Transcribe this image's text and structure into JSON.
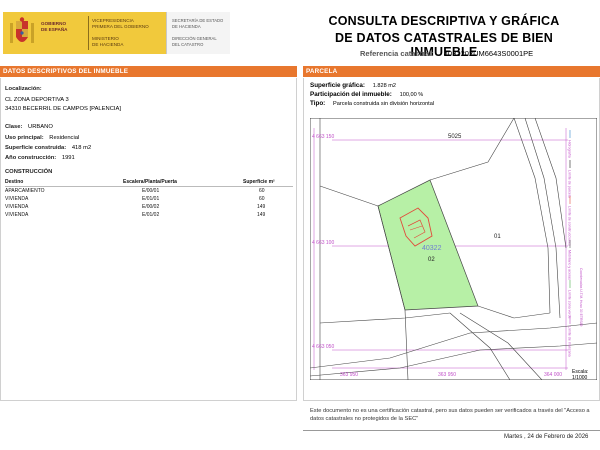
{
  "header": {
    "gov_line1": "GOBIERNO",
    "gov_line2": "DE ESPAÑA",
    "vice_line1": "VICEPRESIDENCIA",
    "vice_line2": "PRIMERA DEL GOBIERNO",
    "vice_line3": "MINISTERIO",
    "vice_line4": "DE HACIENDA",
    "sec_line1": "SECRETARÍA DE ESTADO",
    "sec_line2": "DE HACIENDA",
    "sec_line3": "DIRECCIÓN GENERAL",
    "sec_line4": "DEL CATASTRO",
    "title_line1": "CONSULTA DESCRIPTIVA Y GRÁFICA",
    "title_line2": "DE DATOS CATASTRALES DE BIEN INMUEBLE",
    "ref_label": "Referencia catastral:",
    "ref_value": "4032202UM6643S0001PE",
    "brand_color": "#f1c93c",
    "accent_color": "#e8772e"
  },
  "left": {
    "bar_title": "DATOS DESCRIPTIVOS DEL INMUEBLE",
    "loc_label": "Localización:",
    "loc_line1": "CL ZONA DEPORTIVA 3",
    "loc_line2": "34310 BECERRIL DE CAMPOS [PALENCIA]",
    "clase_label": "Clase:",
    "clase_value": "URBANO",
    "uso_label": "Uso principal:",
    "uso_value": "Residencial",
    "sup_label": "Superficie construida:",
    "sup_value": "418 m2",
    "anio_label": "Año construcción:",
    "anio_value": "1991",
    "constr_title": "CONSTRUCCIÓN",
    "table": {
      "headers": [
        "Destino",
        "Escalera/Planta/Puerta",
        "Superficie m²"
      ],
      "rows": [
        [
          "APARCAMIENTO",
          "E/00/01",
          "60"
        ],
        [
          "VIVIENDA",
          "E/01/01",
          "60"
        ],
        [
          "VIVIENDA",
          "E/00/02",
          "149"
        ],
        [
          "VIVIENDA",
          "E/01/02",
          "149"
        ]
      ]
    }
  },
  "right": {
    "bar_title": "PARCELA",
    "sup_label": "Superficie gráfica:",
    "sup_value": "1.828 m2",
    "part_label": "Participación del inmueble:",
    "part_value": "100,00 %",
    "tipo_label": "Tipo:",
    "tipo_value": "Parcela construida sin división horizontal",
    "map": {
      "coord_top_left": "4 663 150",
      "coord_mid_left": "4 663 100",
      "coord_bot_left": "4 663 050",
      "coord_bottom1": "363 950",
      "coord_bottom2": "363 950",
      "coord_bottom3": "364 000",
      "parcel_5025": "5025",
      "parcel_01": "01",
      "parcel_num": "40322",
      "parcel_02": "02",
      "parcel_fill": "#b7f0a6",
      "building_color": "#e24a3a",
      "legend_1": "Hidrografía",
      "legend_2": "Límite de parcela",
      "legend_3": "Límite de construcciones",
      "legend_4": "Mobiliario y aceras",
      "legend_5": "Límite zona verde",
      "legend_6": "Límite de manzana",
      "coord_system": "Coordenadas U.T.M. Huso 30 ETRS89"
    },
    "scale_label": "Escala:",
    "scale_value": "1/1000"
  },
  "footer": {
    "note": "Este documento no es una certificación catastral, pero sus datos pueden ser verificados a través del \"Acceso a datos catastrales no protegidos de la SEC\"",
    "date": "Martes , 24 de Febrero de 2026"
  }
}
